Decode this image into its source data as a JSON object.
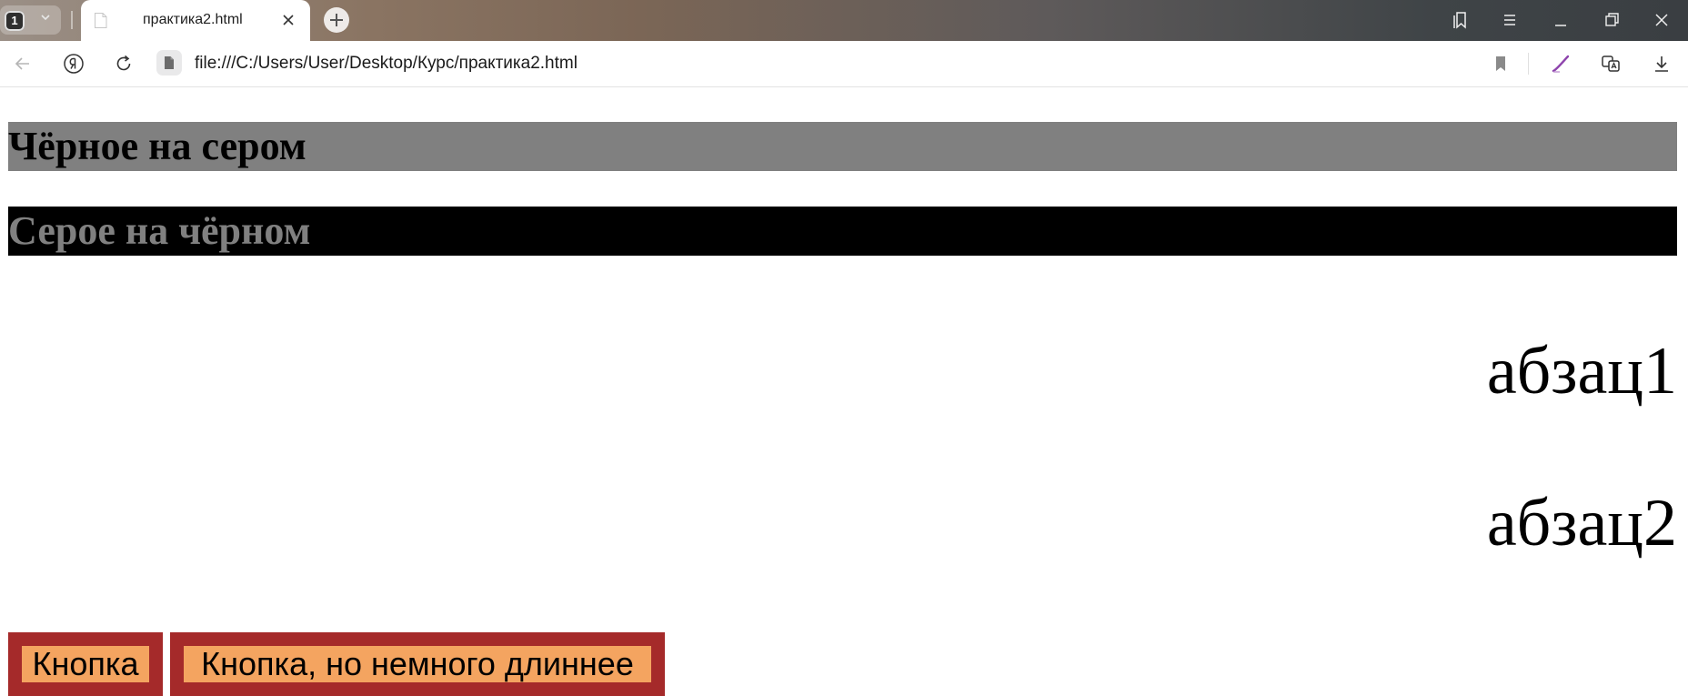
{
  "browser": {
    "tab_count": "1",
    "tab": {
      "title": "практика2.html"
    },
    "address_bar": {
      "url": "file:///C:/Users/User/Desktop/Курс/практика2.html"
    }
  },
  "page": {
    "heading_gray": {
      "text": "Чёрное на сером",
      "background": "#808080",
      "color": "#000000"
    },
    "heading_black": {
      "text": "Серое на чёрном",
      "background": "#000000",
      "color": "#808080"
    },
    "paragraphs": [
      "абзац1",
      "абзац2"
    ],
    "buttons": [
      {
        "label": "Кнопка"
      },
      {
        "label": "Кнопка, но немного длиннее"
      }
    ],
    "button_colors": {
      "background": "#f4a460",
      "border": "#a52a2a"
    }
  },
  "icons": {
    "tab_bar": [
      "chevron-down-icon",
      "page-favicon-icon",
      "close-icon",
      "plus-icon"
    ],
    "window_controls": [
      "collections-icon",
      "menu-icon",
      "minimize-icon",
      "restore-icon",
      "close-window-icon"
    ],
    "toolbar": [
      "back-icon",
      "yandex-icon",
      "reload-icon",
      "file-icon",
      "bookmark-icon",
      "pen-icon",
      "translate-icon",
      "download-icon"
    ]
  }
}
